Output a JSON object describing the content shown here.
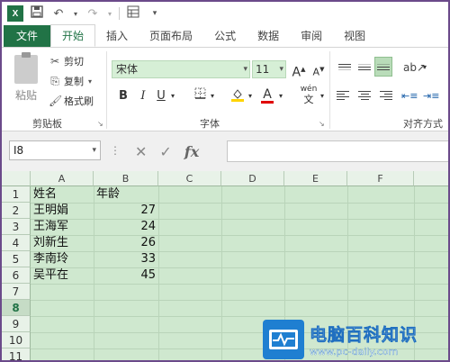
{
  "quick_access": {
    "app_icon": "excel-icon",
    "app_letter": "X",
    "save_icon": "save-icon",
    "undo_icon": "undo-icon",
    "redo_icon": "redo-icon",
    "custom_icon": "form-icon",
    "customize_icon": "customize-icon"
  },
  "tabs": [
    "文件",
    "开始",
    "插入",
    "页面布局",
    "公式",
    "数据",
    "审阅",
    "视图"
  ],
  "ribbon": {
    "clipboard": {
      "paste_label": "粘贴",
      "cut_label": "剪切",
      "copy_label": "复制",
      "format_painter_label": "格式刷",
      "group_label": "剪贴板"
    },
    "font": {
      "font_name": "宋体",
      "font_size": "11",
      "grow_label": "A",
      "shrink_label": "A",
      "bold_label": "B",
      "italic_label": "I",
      "underline_label": "U",
      "font_color_label": "A",
      "phonetic_label": "wén",
      "group_label": "字体"
    },
    "alignment": {
      "group_label": "对齐方式"
    }
  },
  "formula_bar": {
    "name_box": "I8",
    "cancel_icon": "cancel-icon",
    "enter_icon": "check-icon",
    "fx_label": "fx",
    "formula": ""
  },
  "sheet": {
    "columns": [
      "A",
      "B",
      "C",
      "D",
      "E",
      "F"
    ],
    "rows": [
      "1",
      "2",
      "3",
      "4",
      "5",
      "6",
      "7",
      "8",
      "9",
      "10",
      "11"
    ],
    "active_row": "8",
    "cells": {
      "A1": "姓名",
      "B1": "年龄",
      "A2": "王明娟",
      "B2": "27",
      "A3": "王海军",
      "B3": "24",
      "A4": "刘新生",
      "B4": "26",
      "A5": "李南玲",
      "B5": "33",
      "A6": "吴平在",
      "B6": "45"
    }
  },
  "watermark": {
    "title": "电脑百科知识",
    "url": "www.pc-daily.com"
  },
  "colors": {
    "excel_green": "#217346",
    "sheet_fill": "#cfe8cf",
    "frame_border": "#6b4a8a"
  }
}
